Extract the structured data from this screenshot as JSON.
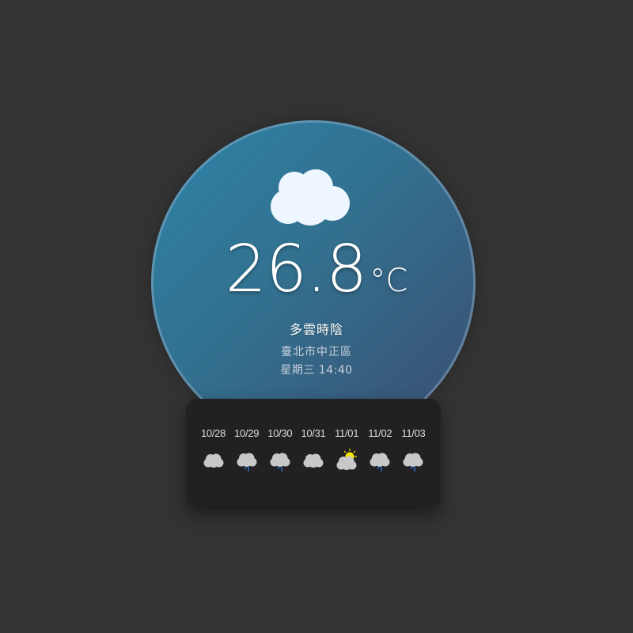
{
  "current": {
    "icon": "cloud-icon",
    "temperature": "26.8",
    "unit": "°C",
    "condition": "多雲時陰",
    "location": "臺北市中正區",
    "datetime": "星期三 14:40"
  },
  "forecast": [
    {
      "date": "10/28",
      "icon": "cloud-icon"
    },
    {
      "date": "10/29",
      "icon": "cloud-rain-icon"
    },
    {
      "date": "10/30",
      "icon": "cloud-rain-icon"
    },
    {
      "date": "10/31",
      "icon": "cloud-icon"
    },
    {
      "date": "11/01",
      "icon": "sun-cloud-icon"
    },
    {
      "date": "11/02",
      "icon": "cloud-rain-icon"
    },
    {
      "date": "11/03",
      "icon": "cloud-rain-icon"
    }
  ],
  "colors": {
    "background": "#333333",
    "orb_start": "#2c83a8",
    "orb_end": "#3b4d70",
    "card": "#232024",
    "cloud_main": "#eef7ff",
    "cloud_small": "#c8c8c8",
    "rain": "#2a7bd4",
    "sun": "#f5e600"
  }
}
